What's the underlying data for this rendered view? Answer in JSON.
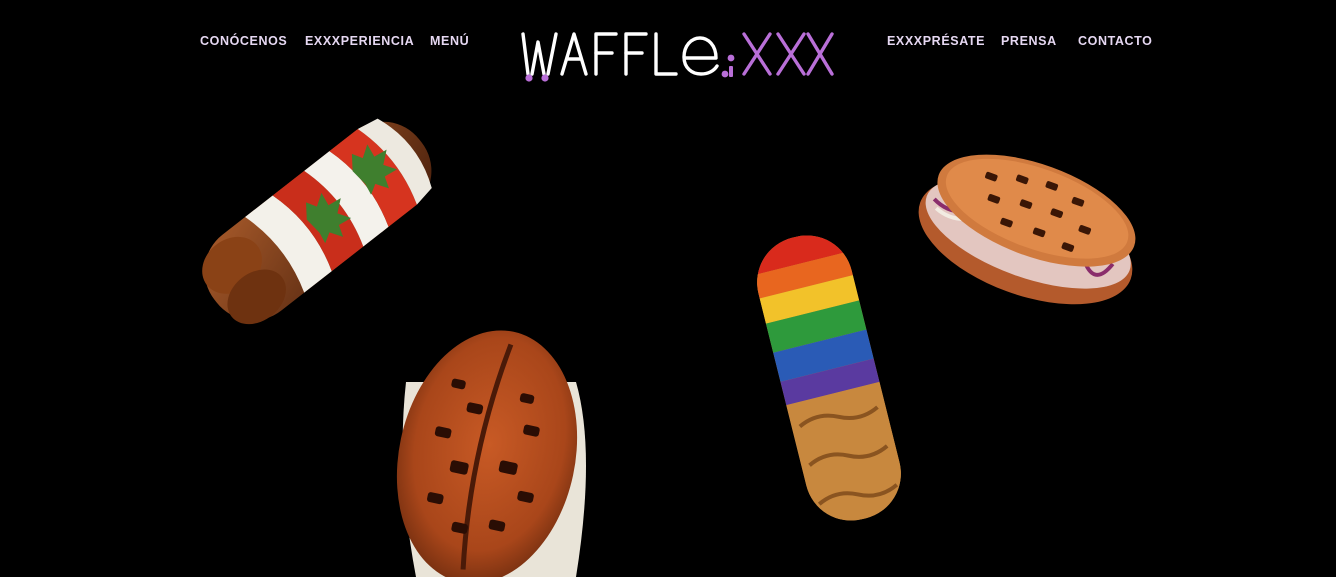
{
  "nav": {
    "left": [
      {
        "label": "CONÓCENOS"
      },
      {
        "label": "EXXXPERIENCIA"
      },
      {
        "label": "MENÚ"
      }
    ],
    "right": [
      {
        "label": "EXXXPRÉSATE"
      },
      {
        "label": "PRENSA"
      },
      {
        "label": "CONTACTO"
      }
    ]
  },
  "logo": {
    "text_main": "WAFFLE",
    "text_accent": "XXX",
    "main_color": "#ffffff",
    "accent_color": "#b96fd8"
  },
  "colors": {
    "background": "#000000",
    "nav_text": "#e6d8f2",
    "accent_purple": "#b96fd8"
  },
  "products": [
    {
      "name": "caprese-waffle",
      "icon": "waffle-caprese-image"
    },
    {
      "name": "orange-waffle",
      "icon": "waffle-grilled-image"
    },
    {
      "name": "rainbow-waffle",
      "icon": "waffle-rainbow-image"
    },
    {
      "name": "sandwich-waffle",
      "icon": "waffle-sandwich-image"
    }
  ]
}
